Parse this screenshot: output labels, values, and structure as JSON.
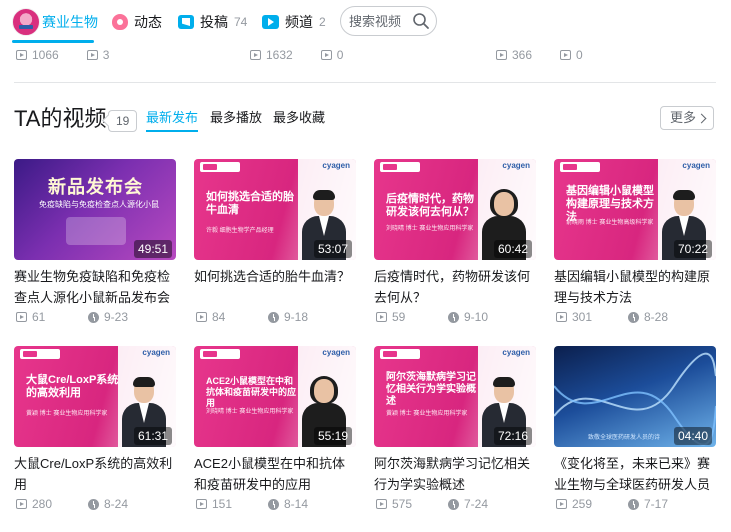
{
  "header": {
    "home_label": "赛业生物",
    "dynamic_label": "动态",
    "submissions_label": "投稿",
    "submissions_count": "74",
    "channels_label": "频道",
    "channels_count": "2",
    "search_placeholder": "搜索视频"
  },
  "partial_row": [
    {
      "views": "1066",
      "comments": "3"
    },
    {
      "views": "1632",
      "comments": "0"
    },
    {
      "views": "366",
      "comments": "0"
    }
  ],
  "section": {
    "title": "TA的视频",
    "count": "19",
    "tabs": [
      "最新发布",
      "最多播放",
      "最多收藏"
    ],
    "more_label": "更多"
  },
  "videos": [
    {
      "title": "赛业生物免疫缺陷和免疫检查点人源化小鼠新品发布会",
      "duration": "49:51",
      "views": "61",
      "date": "9-23",
      "thumb_text": "新品发布会",
      "thumb_sub": "免疫缺陷与免疫检查点人源化小鼠"
    },
    {
      "title": "如何挑选合适的胎牛血清？",
      "duration": "53:07",
      "views": "84",
      "date": "9-18",
      "thumb_text": "如何挑选合适的胎牛血清",
      "thumb_speaker": "许毅 细胞生物学产品经理",
      "brand": "cyagen"
    },
    {
      "title": "后疫情时代，药物研发该何去何从？",
      "duration": "60:42",
      "views": "59",
      "date": "9-10",
      "thumb_text": "后疫情时代，药物研发该何去何从？",
      "thumb_speaker": "刘晓晴 博士 赛业生物应用科学家",
      "brand": "cyagen"
    },
    {
      "title": "基因编辑小鼠模型的构建原理与技术方法",
      "duration": "70:22",
      "views": "301",
      "date": "8-28",
      "thumb_text": "基因编辑小鼠模型构建原理与技术方法",
      "thumb_speaker": "俞晓雨 博士 赛业生物高级科学家",
      "brand": "cyagen"
    },
    {
      "title": "大鼠Cre/LoxP系统的高效利用",
      "duration": "61:31",
      "views": "280",
      "date": "8-24",
      "thumb_text": "大鼠Cre/LoxP系统的高效利用",
      "thumb_speaker": "黄颖 博士 赛业生物应用科学家",
      "brand": "cyagen"
    },
    {
      "title": "ACE2小鼠模型在中和抗体和疫苗研发中的应用",
      "duration": "55:19",
      "views": "151",
      "date": "8-14",
      "thumb_text": "ACE2小鼠模型在中和抗体和疫苗研发中的应用",
      "thumb_speaker": "刘晓晴 博士 赛业生物应用科学家",
      "brand": "cyagen"
    },
    {
      "title": "阿尔茨海默病学习记忆相关行为学实验概述",
      "duration": "72:16",
      "views": "575",
      "date": "7-24",
      "thumb_text": "阿尔茨海默病学习记忆相关行为学实验概述",
      "thumb_speaker": "黄颖 博士 赛业生物应用科学家",
      "brand": "cyagen"
    },
    {
      "title": "《变化将至，未来已来》赛业生物与全球医药研发人员共拓",
      "duration": "04:40",
      "views": "259",
      "date": "7-17",
      "thumb_text": "致敬全球医药研发人员的诗"
    }
  ],
  "colors": {
    "accent": "#00aeec",
    "pink": "#fb7299",
    "muted": "#9499a0"
  }
}
